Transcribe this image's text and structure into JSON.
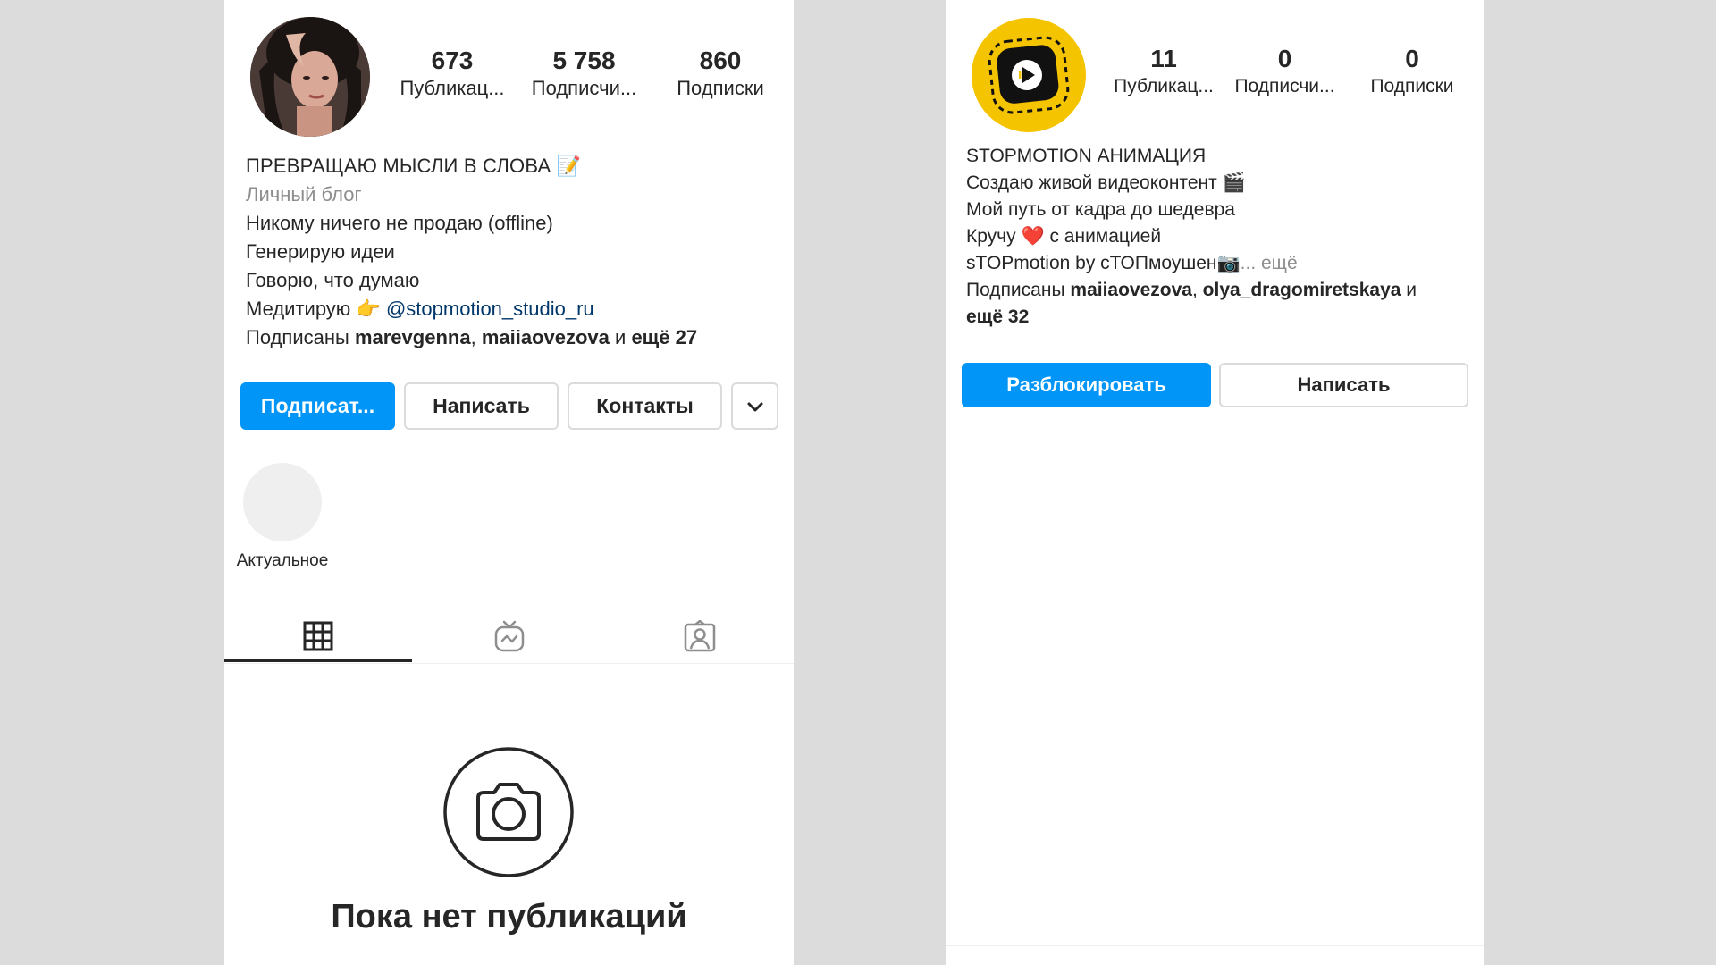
{
  "left_profile": {
    "stats": [
      {
        "value": "673",
        "label": "Публикац..."
      },
      {
        "value": "5 758",
        "label": "Подписчи..."
      },
      {
        "value": "860",
        "label": "Подписки"
      }
    ],
    "name": "ПРЕВРАЩАЮ МЫСЛИ В СЛОВА",
    "name_emoji": "📝",
    "category": "Личный блог",
    "bio_lines": [
      "Никому ничего не продаю (offline)",
      "Генерирую идеи",
      "Говорю, что думаю"
    ],
    "bio_mention_prefix": "Медитирую",
    "bio_mention_emoji": "👉",
    "bio_mention": "@stopmotion_studio_ru",
    "followed_prefix": "Подписаны",
    "followed_user1": "marevgenna",
    "followed_sep": ",",
    "followed_user2": "maiiaovezova",
    "followed_and": "и",
    "followed_more": "ещё 27",
    "buttons": {
      "follow": "Подписат...",
      "message": "Написать",
      "contacts": "Контакты"
    },
    "highlight_label": "Актуальное",
    "empty_title": "Пока нет публикаций"
  },
  "right_profile": {
    "stats": [
      {
        "value": "11",
        "label": "Публикац..."
      },
      {
        "value": "0",
        "label": "Подписчи..."
      },
      {
        "value": "0",
        "label": "Подписки"
      }
    ],
    "name": "STOPMOTION АНИМАЦИЯ",
    "bio_line1": "Создаю живой видеоконтент",
    "bio_line1_emoji": "🎬",
    "bio_line2": "Мой путь от кадра до шедевра",
    "bio_line3_a": "Кручу",
    "bio_line3_emoji": "❤️",
    "bio_line3_b": "с анимацией",
    "bio_line4": "sTOPmotion by cТОПмоушен",
    "bio_line4_emoji": "📷",
    "bio_line4_more": "... ещё",
    "followed_prefix": "Подписаны",
    "followed_user1": "maiiaovezova",
    "followed_sep": ",",
    "followed_user2": "olya_dragomiretskaya",
    "followed_and": "и",
    "followed_more": "ещё 32",
    "buttons": {
      "unblock": "Разблокировать",
      "message": "Написать"
    }
  },
  "colors": {
    "primary_button": "#0095f6",
    "link": "#00376b",
    "secondary_text": "#8e8e8e",
    "logo_yellow": "#f5c400"
  },
  "icons": [
    "grid-icon",
    "igtv-icon",
    "tagged-icon",
    "chevron-down-icon",
    "camera-icon"
  ]
}
